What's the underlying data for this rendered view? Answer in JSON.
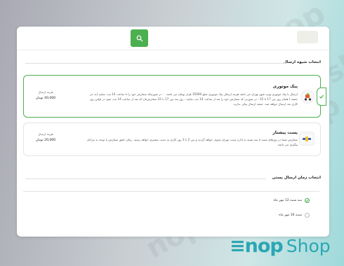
{
  "watermark": "nopshop",
  "shipping_method": {
    "title": "انتخاب شیوه ارسال",
    "options": [
      {
        "name": "پیک موتوری",
        "description": "ارسال با پیک موتوری ویژه شهر تهران می باشد هزینه ارسال پیک موتوری مبلغ 35000 هزار تومان می باشد . - در صورتیکه سفارش خود را تا ساعت 14 ثبت نمایید (به جز جمعه ) همان روز بین 17 تا 22 - در صورتی که سفارش خود را بعد از ساعت 14 ثبت نمایید ، روز بعد بین 17 تا 22 سفارش‌تان که بعد از ساعت 14 ثبت شود در اولین روز کاری بعد ارسال خواهد شد. جمعه ارسال پیکی ندارید",
        "price_label": "هزینه ارسال",
        "price": "40,000 تومان",
        "selected": true,
        "icon": "delivery-scooter-icon"
      },
      {
        "name": "پست پیشتاز",
        "description": "سفارش شما در روزهای شنبه تا سه شنبه به اداره پست تهران تحویل خواهد گردید و بین 2 تا 3 روز کاری به دست مشتری خواهد رسید. زمان دقیق سفارش با توجه به مراحل پیگیری می باشد.",
        "price_label": "هزینه ارسال",
        "price": "20,000 تومان",
        "selected": false,
        "icon": "post-logo-icon"
      }
    ]
  },
  "shipping_time": {
    "title": "انتخاب زمان ارسال پستی",
    "options": [
      {
        "label": "سه شنبه 12 مهر ماه",
        "selected": true
      },
      {
        "label": "شنبه 16 مهر ماه",
        "selected": false
      }
    ]
  },
  "branding": {
    "mark": "≡nop",
    "shop": "Shop"
  },
  "colors": {
    "accent": "#4caf50",
    "brand": "#2aa7b3"
  }
}
